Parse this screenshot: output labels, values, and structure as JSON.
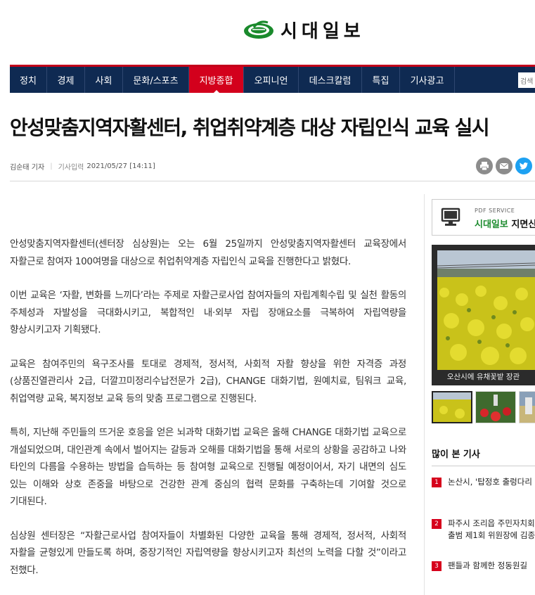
{
  "header": {
    "logo_text": "시대일보"
  },
  "nav": {
    "items": [
      {
        "label": "정치"
      },
      {
        "label": "경제"
      },
      {
        "label": "사회"
      },
      {
        "label": "문화/스포츠"
      },
      {
        "label": "지방종합",
        "active": true
      },
      {
        "label": "오피니언"
      },
      {
        "label": "데스크칼럼"
      },
      {
        "label": "특집"
      },
      {
        "label": "기사광고"
      }
    ],
    "search_placeholder": "검색"
  },
  "article": {
    "title": "안성맞춤지역자활센터, 취업취약계층 대상 자립인식 교육 실시",
    "author": "김순태 기자",
    "date_label": "기사입력",
    "date": "2021/05/27 [14:11]",
    "paragraphs": [
      "안성맞춤지역자활센터(센터장 심상원)는 오는 6월 25일까지 안성맞춤지역자활센터 교육장에서 자활근로 참여자 100여명을 대상으로 취업취약계층 자립인식 교육을 진행한다고 밝혔다.",
      "이번 교육은 ‘자활, 변화를 느끼다’라는 주제로 자활근로사업 참여자들의 자립계획수립 및 실천 활동의 주체성과 자발성을 극대화시키고, 복합적인 내·외부 자립 장애요소를 극복하여 자립역량을 향상시키고자 기획됐다.",
      "교육은 참여주민의 욕구조사를 토대로 경제적, 정서적, 사회적 자활 향상을 위한 자격증 과정(상품진열관리사 2급, 더깔끄미정리수납전문가 2급), CHANGE 대화기법, 원예치료, 팀워크 교육, 취업역량 교육, 복지정보 교육 등의 맞춤 프로그램으로 진행된다.",
      "특히, 지난해 주민들의 뜨거운 호응을 얻은 뇌과학 대화기법 교육은 올해 CHANGE 대화기법 교육으로 개설되었으며, 대인관계 속에서 벌어지는 갈등과 오해를 대화기법을 통해 서로의 상황을 공감하고 나와 타인의 다름을 수용하는 방법을 습득하는 등 참여형 교육으로 진행될 예정이어서, 자기 내면의 심도 있는 이해와 상호 존중을 바탕으로 건강한 관계 중심의 협력 문화를 구축하는데 기여할 것으로 기대된다.",
      "심상원 센터장은 “자활근로사업 참여자들이 차별화된 다양한 교육을 통해 경제적, 정서적, 사회적 자활을 균형있게 만들도록 하며, 중장기적인 자립역량을 향상시키고자 최선의 노력을 다할 것”이라고 전했다."
    ]
  },
  "sidebar": {
    "pdf_small": "PDF SERVICE",
    "pdf_big_accent": "시대일보",
    "pdf_big_rest": " 지면신",
    "gallery_caption": "오산시에 유채꽃밭 장관",
    "popular_title": "많이 본 기사",
    "popular": [
      {
        "num": "1",
        "line1": "논산시, '탑정호 출렁다리",
        "line2": ""
      },
      {
        "num": "2",
        "line1": "파주시 조리읍 주민자치회",
        "line2": "출범 제1회 위원장에 김종"
      },
      {
        "num": "3",
        "line1": "팬들과 함께한 정동원길",
        "line2": ""
      }
    ]
  },
  "icons": {
    "print": "print-icon",
    "email": "email-icon",
    "twitter": "twitter-icon",
    "monitor": "monitor-icon"
  },
  "colors": {
    "nav_bg": "#0f2a52",
    "nav_active": "#d3001c",
    "logo_green": "#1a8a2c",
    "rank_red": "#d6001c",
    "twitter_blue": "#1da1f2"
  }
}
